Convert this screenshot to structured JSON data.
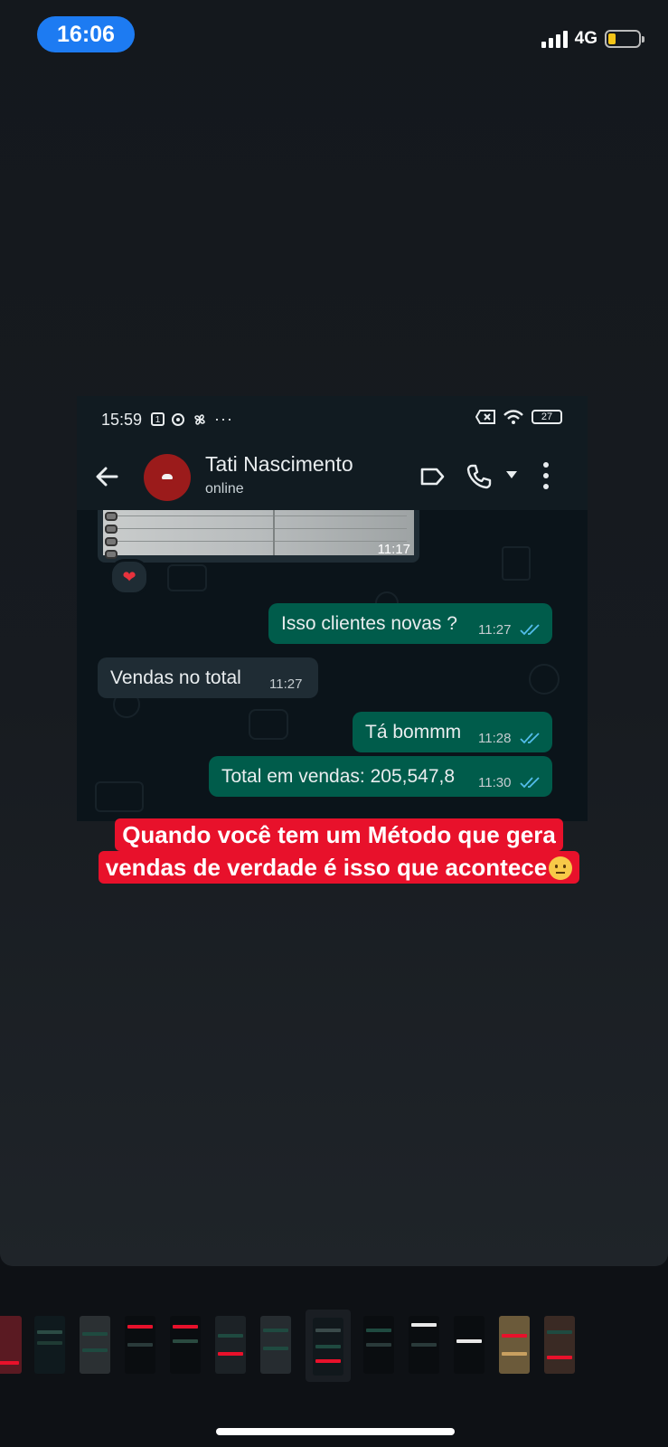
{
  "ios_status": {
    "time": "16:06",
    "network": "4G",
    "battery_level": 0.25
  },
  "screenshot": {
    "status": {
      "time": "15:59",
      "battery": "27",
      "extra": "···"
    },
    "header": {
      "name": "Tati Nascimento",
      "status": "online"
    },
    "messages": [
      {
        "type": "image",
        "direction": "in",
        "time": "11:17",
        "reaction": "❤"
      },
      {
        "direction": "out",
        "text": "Isso clientes novas ?",
        "time": "11:27",
        "read": true
      },
      {
        "direction": "in",
        "text": "Vendas no total",
        "time": "11:27"
      },
      {
        "direction": "out",
        "text": "Tá bommm",
        "time": "11:28",
        "read": true
      },
      {
        "direction": "out",
        "text": "Total em vendas: 205,547,8",
        "time": "11:30",
        "read": true
      }
    ]
  },
  "caption": {
    "line1": "Quando você tem um Método que gera",
    "line2": "vendas de verdade é isso que acontece"
  },
  "colors": {
    "caption_bg": "#e8112b",
    "outgoing": "#005c4b",
    "incoming": "#1f2c34",
    "ios_time_pill": "#1d7bf2",
    "read_ticks": "#53bdeb"
  },
  "icons": [
    "back-arrow-icon",
    "label-icon",
    "phone-icon",
    "dropdown-icon",
    "more-vert-icon",
    "wifi-icon",
    "heart-icon",
    "double-check-icon"
  ]
}
